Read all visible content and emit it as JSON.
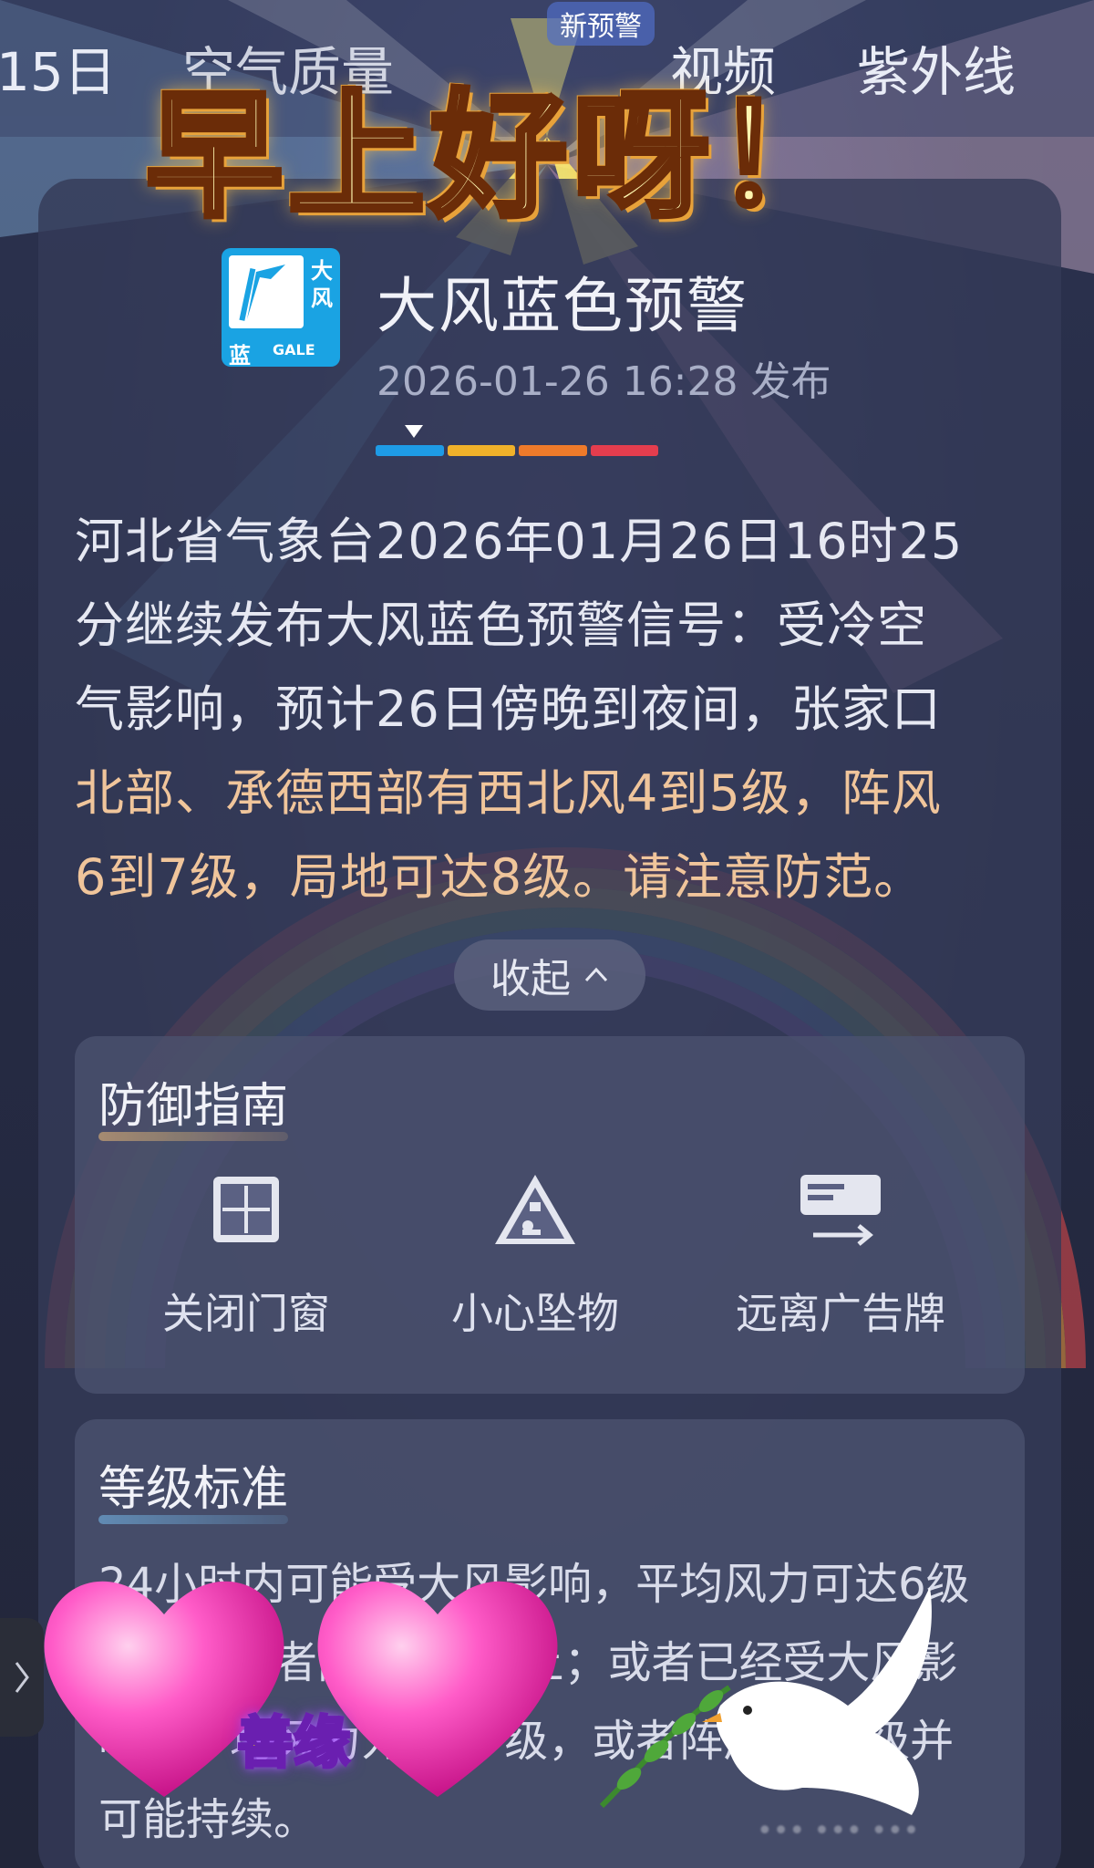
{
  "top_tabs": {
    "day15": "15日",
    "air": "空气质量",
    "video": "视频",
    "uv": "紫外线",
    "new_badge": "新预警"
  },
  "overlay": {
    "greeting": "早上好呀！",
    "tag": "善缘"
  },
  "warning": {
    "icon_side_text": "大风",
    "icon_level": "蓝",
    "icon_gale": "GALE",
    "title": "大风蓝色预警",
    "time": "2026-01-26 16:28 发布",
    "levels": [
      "#1e9be6",
      "#f0b12a",
      "#ee7a2a",
      "#e43d4e"
    ],
    "current_level_index": 0,
    "body_line1": "河北省气象台2026年01月26日16时25",
    "body_line2": "分继续发布大风蓝色预警信号：受冷空",
    "body_line3": "气影响，预计26日傍晚到夜间，张家口",
    "body_line4": "北部、承德西部有西北风4到5级，阵风",
    "body_line5": "6到7级，局地可达8级。请注意防范。",
    "collapse_label": "收起"
  },
  "guide": {
    "title": "防御指南",
    "items": [
      {
        "label": "关闭门窗",
        "icon": "window-icon"
      },
      {
        "label": "小心坠物",
        "icon": "falling-object-icon"
      },
      {
        "label": "远离广告牌",
        "icon": "billboard-icon"
      }
    ]
  },
  "standard": {
    "title": "等级标准",
    "line1": "24小时内可能受大风影响，平均风力可达6级",
    "line2": "以上，或者阵风7级以上；或者已经受大风影",
    "line3": "响，平均风力为6～7级，或者阵风7～8级并",
    "line4": "可能持续。"
  },
  "watermark": "••• ••• •••"
}
